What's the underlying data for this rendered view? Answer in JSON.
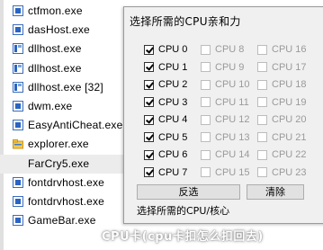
{
  "processes": [
    {
      "name": "ctfmon.exe",
      "icon": "generic-exe-icon"
    },
    {
      "name": "dasHost.exe",
      "icon": "generic-exe-icon"
    },
    {
      "name": "dllhost.exe",
      "icon": "dll-host-icon"
    },
    {
      "name": "dllhost.exe",
      "icon": "dll-host-icon"
    },
    {
      "name": "dllhost.exe [32]",
      "icon": "dll-host-icon"
    },
    {
      "name": "dwm.exe",
      "icon": "generic-exe-icon"
    },
    {
      "name": "EasyAntiCheat.exe",
      "icon": "generic-exe-icon"
    },
    {
      "name": "explorer.exe",
      "icon": "explorer-folder-icon"
    },
    {
      "name": "FarCry5.exe",
      "icon": "none",
      "selected": true
    },
    {
      "name": "fontdrvhost.exe",
      "icon": "generic-exe-icon"
    },
    {
      "name": "fontdrvhost.exe",
      "icon": "generic-exe-icon"
    },
    {
      "name": "GameBar.exe",
      "icon": "generic-exe-icon"
    }
  ],
  "dialog": {
    "title": "选择所需的CPU亲和力",
    "cpus": [
      {
        "label": "CPU 0",
        "checked": true,
        "enabled": true
      },
      {
        "label": "CPU 1",
        "checked": true,
        "enabled": true
      },
      {
        "label": "CPU 2",
        "checked": true,
        "enabled": true
      },
      {
        "label": "CPU 3",
        "checked": true,
        "enabled": true
      },
      {
        "label": "CPU 4",
        "checked": true,
        "enabled": true
      },
      {
        "label": "CPU 5",
        "checked": true,
        "enabled": true
      },
      {
        "label": "CPU 6",
        "checked": true,
        "enabled": true
      },
      {
        "label": "CPU 7",
        "checked": true,
        "enabled": true
      },
      {
        "label": "CPU 8",
        "checked": false,
        "enabled": false
      },
      {
        "label": "CPU 9",
        "checked": false,
        "enabled": false
      },
      {
        "label": "CPU 10",
        "checked": false,
        "enabled": false
      },
      {
        "label": "CPU 11",
        "checked": false,
        "enabled": false
      },
      {
        "label": "CPU 12",
        "checked": false,
        "enabled": false
      },
      {
        "label": "CPU 13",
        "checked": false,
        "enabled": false
      },
      {
        "label": "CPU 14",
        "checked": false,
        "enabled": false
      },
      {
        "label": "CPU 15",
        "checked": false,
        "enabled": false
      },
      {
        "label": "CPU 16",
        "checked": false,
        "enabled": false
      },
      {
        "label": "CPU 17",
        "checked": false,
        "enabled": false
      },
      {
        "label": "CPU 18",
        "checked": false,
        "enabled": false
      },
      {
        "label": "CPU 19",
        "checked": false,
        "enabled": false
      },
      {
        "label": "CPU 20",
        "checked": false,
        "enabled": false
      },
      {
        "label": "CPU 21",
        "checked": false,
        "enabled": false
      },
      {
        "label": "CPU 22",
        "checked": false,
        "enabled": false
      },
      {
        "label": "CPU 23",
        "checked": false,
        "enabled": false
      }
    ],
    "invert_button": "反选",
    "clear_button": "清除",
    "status": "选择所需的CPU/核心"
  },
  "watermark": "CPU卡(cpu卡扣怎么扣回去)"
}
